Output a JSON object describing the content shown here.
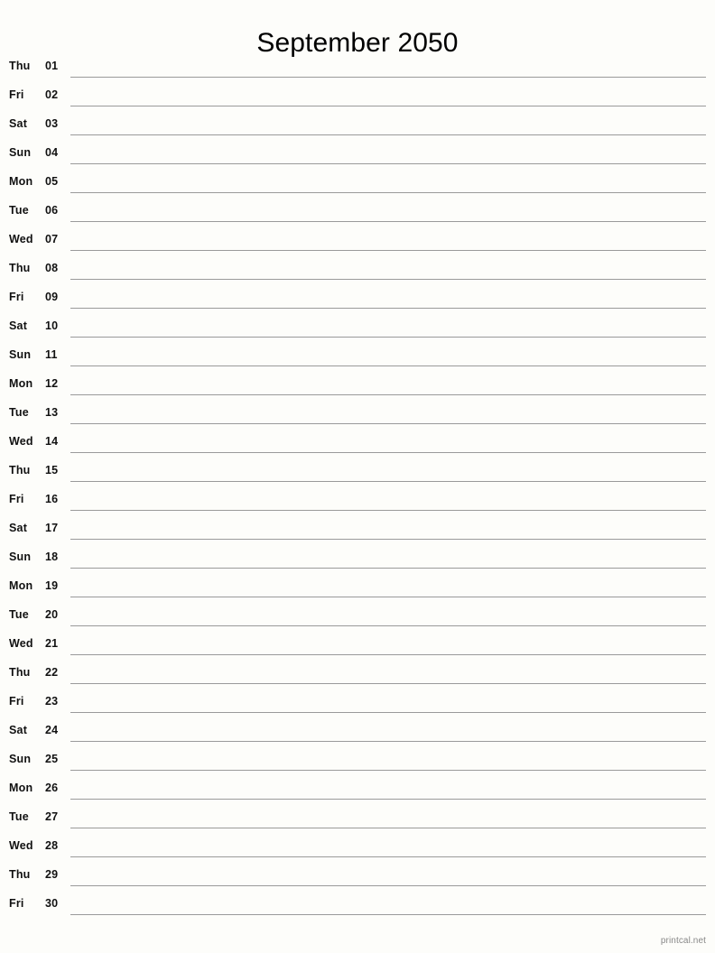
{
  "document": {
    "title": "September 2050",
    "footer": "printcal.net",
    "colors": {
      "background": "#fdfdfa",
      "text": "#111111",
      "rule": "#9a9a9a",
      "footer_text": "#888888"
    }
  },
  "days": [
    {
      "weekday": "Thu",
      "date": "01"
    },
    {
      "weekday": "Fri",
      "date": "02"
    },
    {
      "weekday": "Sat",
      "date": "03"
    },
    {
      "weekday": "Sun",
      "date": "04"
    },
    {
      "weekday": "Mon",
      "date": "05"
    },
    {
      "weekday": "Tue",
      "date": "06"
    },
    {
      "weekday": "Wed",
      "date": "07"
    },
    {
      "weekday": "Thu",
      "date": "08"
    },
    {
      "weekday": "Fri",
      "date": "09"
    },
    {
      "weekday": "Sat",
      "date": "10"
    },
    {
      "weekday": "Sun",
      "date": "11"
    },
    {
      "weekday": "Mon",
      "date": "12"
    },
    {
      "weekday": "Tue",
      "date": "13"
    },
    {
      "weekday": "Wed",
      "date": "14"
    },
    {
      "weekday": "Thu",
      "date": "15"
    },
    {
      "weekday": "Fri",
      "date": "16"
    },
    {
      "weekday": "Sat",
      "date": "17"
    },
    {
      "weekday": "Sun",
      "date": "18"
    },
    {
      "weekday": "Mon",
      "date": "19"
    },
    {
      "weekday": "Tue",
      "date": "20"
    },
    {
      "weekday": "Wed",
      "date": "21"
    },
    {
      "weekday": "Thu",
      "date": "22"
    },
    {
      "weekday": "Fri",
      "date": "23"
    },
    {
      "weekday": "Sat",
      "date": "24"
    },
    {
      "weekday": "Sun",
      "date": "25"
    },
    {
      "weekday": "Mon",
      "date": "26"
    },
    {
      "weekday": "Tue",
      "date": "27"
    },
    {
      "weekday": "Wed",
      "date": "28"
    },
    {
      "weekday": "Thu",
      "date": "29"
    },
    {
      "weekday": "Fri",
      "date": "30"
    }
  ]
}
